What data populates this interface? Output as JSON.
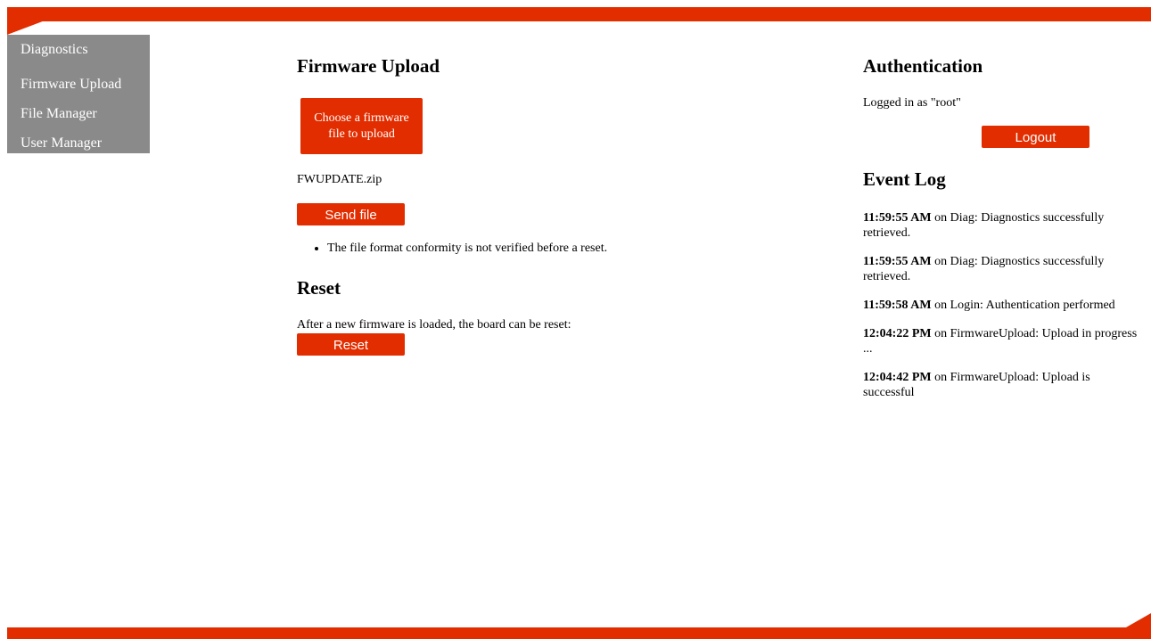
{
  "nav": {
    "items": [
      {
        "label": "Diagnostics"
      },
      {
        "label": "Firmware Upload"
      },
      {
        "label": "File Manager"
      },
      {
        "label": "User Manager"
      }
    ]
  },
  "firmware_upload": {
    "title": "Firmware Upload",
    "choose_button_label": "Choose a firmware file to upload",
    "selected_file": "FWUPDATE.zip",
    "send_button_label": "Send file",
    "notes": [
      "The file format conformity is not verified before a reset."
    ]
  },
  "reset": {
    "title": "Reset",
    "description": "After a new firmware is loaded, the board can be reset:",
    "button_label": "Reset"
  },
  "authentication": {
    "title": "Authentication",
    "status": "Logged in as \"root\"",
    "logout_label": "Logout"
  },
  "event_log": {
    "title": "Event Log",
    "entries": [
      {
        "time": "11:59:55 AM",
        "message": " on Diag: Diagnostics successfully retrieved."
      },
      {
        "time": "11:59:55 AM",
        "message": " on Diag: Diagnostics successfully retrieved."
      },
      {
        "time": "11:59:58 AM",
        "message": " on Login: Authentication performed"
      },
      {
        "time": "12:04:22 PM",
        "message": " on FirmwareUpload: Upload in progress ..."
      },
      {
        "time": "12:04:42 PM",
        "message": " on FirmwareUpload: Upload is successful"
      }
    ]
  },
  "theme": {
    "accent": "#e22d00",
    "sidebar_bg": "#8a8a8a"
  }
}
